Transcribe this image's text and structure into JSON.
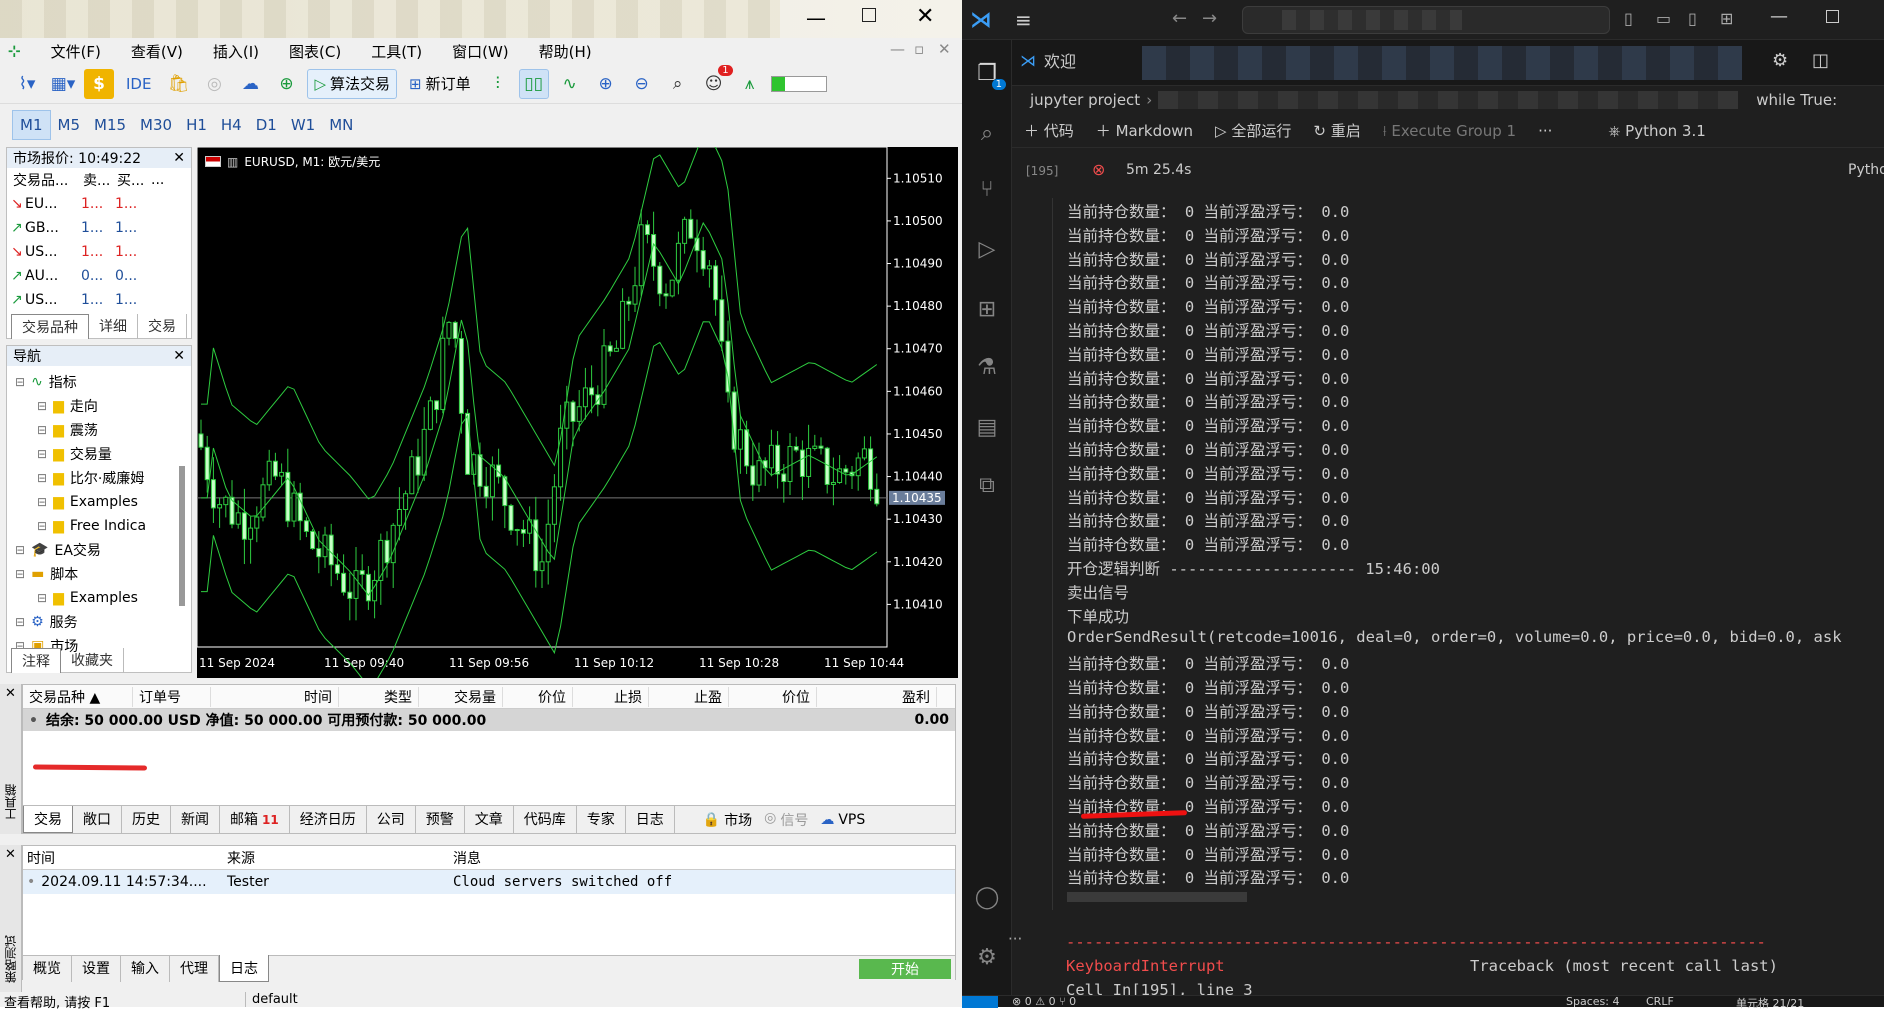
{
  "mt5": {
    "menu": [
      "文件(F)",
      "查看(V)",
      "插入(I)",
      "图表(C)",
      "工具(T)",
      "窗口(W)",
      "帮助(H)"
    ],
    "toolbar": {
      "ide": "IDE",
      "algo": "算法交易",
      "new_order": "新订单",
      "notif_count": "1"
    },
    "timeframes": [
      "M1",
      "M5",
      "M15",
      "M30",
      "H1",
      "H4",
      "D1",
      "W1",
      "MN"
    ],
    "market_watch": {
      "title": "市场报价: 10:49:22",
      "cols": [
        "交易品...",
        "卖...",
        "买...",
        "..."
      ],
      "rows": [
        {
          "sym": "EU...",
          "bid": "1...",
          "ask": "1...",
          "dir": "down"
        },
        {
          "sym": "GB...",
          "bid": "1...",
          "ask": "1...",
          "dir": "up"
        },
        {
          "sym": "US...",
          "bid": "1...",
          "ask": "1...",
          "dir": "down"
        },
        {
          "sym": "AU...",
          "bid": "0...",
          "ask": "0...",
          "dir": "up"
        },
        {
          "sym": "US...",
          "bid": "1...",
          "ask": "1...",
          "dir": "up"
        }
      ],
      "tabs": [
        "交易品种",
        "详细",
        "交易"
      ]
    },
    "navigator": {
      "title": "导航",
      "items": [
        {
          "label": "指标",
          "level": 0,
          "icon": "indicator-icon"
        },
        {
          "label": "走向",
          "level": 1,
          "icon": "folder-icon"
        },
        {
          "label": "震荡",
          "level": 1,
          "icon": "folder-icon"
        },
        {
          "label": "交易量",
          "level": 1,
          "icon": "folder-icon"
        },
        {
          "label": "比尔·威廉姆",
          "level": 1,
          "icon": "folder-icon"
        },
        {
          "label": "Examples",
          "level": 1,
          "icon": "folder-icon"
        },
        {
          "label": "Free Indica",
          "level": 1,
          "icon": "folder-icon"
        },
        {
          "label": "EA交易",
          "level": 0,
          "icon": "hat-icon"
        },
        {
          "label": "脚本",
          "level": 0,
          "icon": "script-icon"
        },
        {
          "label": "Examples",
          "level": 1,
          "icon": "folder-icon"
        },
        {
          "label": "服务",
          "level": 0,
          "icon": "gear-icon"
        },
        {
          "label": "市场",
          "level": 0,
          "icon": "market-icon"
        }
      ],
      "tabs": [
        "注释",
        "收藏夹"
      ]
    },
    "chart": {
      "title": "EURUSD, M1:  欧元/美元",
      "current_price": "1.10435",
      "y_ticks": [
        "1.10510",
        "1.10500",
        "1.10490",
        "1.10480",
        "1.10470",
        "1.10460",
        "1.10450",
        "1.10440",
        "1.10430",
        "1.10420",
        "1.10410"
      ],
      "x_ticks": [
        "11 Sep 2024",
        "11 Sep 09:40",
        "11 Sep 09:56",
        "11 Sep 10:12",
        "11 Sep 10:28",
        "11 Sep 10:44"
      ]
    },
    "trade": {
      "cols": [
        "交易品种",
        "订单号",
        "时间",
        "类型",
        "交易量",
        "价位",
        "止损",
        "止盈",
        "价位",
        "盈利"
      ],
      "balance": "结余: 50 000.00 USD  净值: 50 000.00  可用预付款: 50 000.00",
      "profit": "0.00",
      "tabs": [
        "交易",
        "敞口",
        "历史",
        "新闻",
        "邮箱",
        "经济日历",
        "公司",
        "预警",
        "文章",
        "代码库",
        "专家",
        "日志"
      ],
      "mail_count": "11",
      "market": "市场",
      "signals": "信号",
      "vps": "VPS",
      "side_label": "工具箱"
    },
    "tester": {
      "cols": [
        "时间",
        "来源",
        "消息"
      ],
      "row": {
        "time": "2024.09.11 14:57:34....",
        "source": "Tester",
        "message": "Cloud servers switched off"
      },
      "tabs": [
        "概览",
        "设置",
        "输入",
        "代理",
        "日志"
      ],
      "start": "开始",
      "side_label": "策略测试"
    },
    "status": {
      "help": "查看帮助, 请按 F1",
      "profile": "default"
    }
  },
  "vscode": {
    "tab_welcome": "欢迎",
    "breadcrumb": {
      "project": "jupyter project",
      "code": "while True:"
    },
    "nb_toolbar": {
      "code": "代码",
      "markdown": "Markdown",
      "run_all": "全部运行",
      "restart": "重启",
      "exec_group": "Execute Group 1",
      "kernel": "Python 3.1",
      "kernel2": "Pytho"
    },
    "cell": {
      "exec_count": "[195]",
      "duration": "5m 25.4s"
    },
    "output_lines": [
      "当前持仓数量： 0 当前浮盈浮亏： 0.0",
      "当前持仓数量： 0 当前浮盈浮亏： 0.0",
      "当前持仓数量： 0 当前浮盈浮亏： 0.0",
      "当前持仓数量： 0 当前浮盈浮亏： 0.0",
      "当前持仓数量： 0 当前浮盈浮亏： 0.0",
      "当前持仓数量： 0 当前浮盈浮亏： 0.0",
      "当前持仓数量： 0 当前浮盈浮亏： 0.0",
      "当前持仓数量： 0 当前浮盈浮亏： 0.0",
      "当前持仓数量： 0 当前浮盈浮亏： 0.0",
      "当前持仓数量： 0 当前浮盈浮亏： 0.0",
      "当前持仓数量： 0 当前浮盈浮亏： 0.0",
      "当前持仓数量： 0 当前浮盈浮亏： 0.0",
      "当前持仓数量： 0 当前浮盈浮亏： 0.0",
      "当前持仓数量： 0 当前浮盈浮亏： 0.0",
      "当前持仓数量： 0 当前浮盈浮亏： 0.0",
      "开仓逻辑判断 -------------------- 15:46:00",
      "卖出信号",
      "下单成功",
      "OrderSendResult(retcode=10016, deal=0, order=0, volume=0.0, price=0.0, bid=0.0, ask",
      "当前持仓数量： 0 当前浮盈浮亏： 0.0",
      "当前持仓数量： 0 当前浮盈浮亏： 0.0",
      "当前持仓数量： 0 当前浮盈浮亏： 0.0",
      "当前持仓数量： 0 当前浮盈浮亏： 0.0",
      "当前持仓数量： 0 当前浮盈浮亏： 0.0",
      "当前持仓数量： 0 当前浮盈浮亏： 0.0",
      "当前持仓数量： 0 当前浮盈浮亏： 0.0",
      "当前持仓数量： 0 当前浮盈浮亏： 0.0",
      "当前持仓数量： 0 当前浮盈浮亏： 0.0",
      "当前持仓数量： 0 当前浮盈浮亏： 0.0"
    ],
    "error": {
      "dashes": "---------------------------------------------------------------------------",
      "name": "KeyboardInterrupt",
      "trace": "Traceback (most recent call last)",
      "cell_ref": "Cell In[195], line 3"
    },
    "status": {
      "problems": "0",
      "warnings": "0",
      "ports": "0",
      "spaces": "Spaces: 4",
      "eol": "CRLF",
      "cellpos": "单元格 21/21"
    },
    "badge": "1"
  }
}
